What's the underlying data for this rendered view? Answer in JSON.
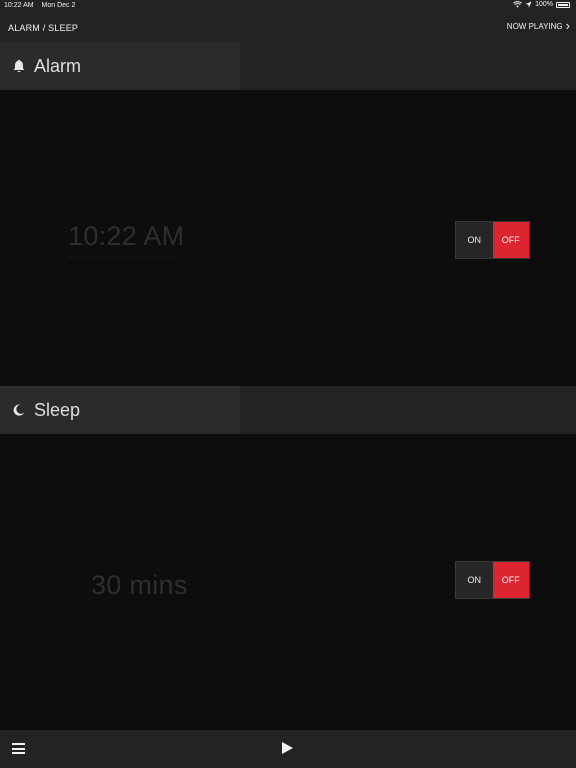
{
  "status": {
    "time": "10:22 AM",
    "date": "Mon Dec 2",
    "battery": "100%"
  },
  "nav": {
    "title": "ALARM / SLEEP",
    "now_playing": "NOW PLAYING"
  },
  "alarm": {
    "label": "Alarm",
    "time": "10:22 AM",
    "on_label": "ON",
    "off_label": "OFF",
    "state": "off"
  },
  "sleep": {
    "label": "Sleep",
    "duration": "30 mins",
    "on_label": "ON",
    "off_label": "OFF",
    "state": "off"
  },
  "icons": {
    "alarm": "bell-icon",
    "sleep": "moon-icon",
    "menu": "menu-icon",
    "play": "play-icon",
    "now_playing": "chevron-right-icon"
  },
  "colors": {
    "accent_off": "#dc2530",
    "bar": "#232323",
    "background": "#0d0d0d"
  }
}
